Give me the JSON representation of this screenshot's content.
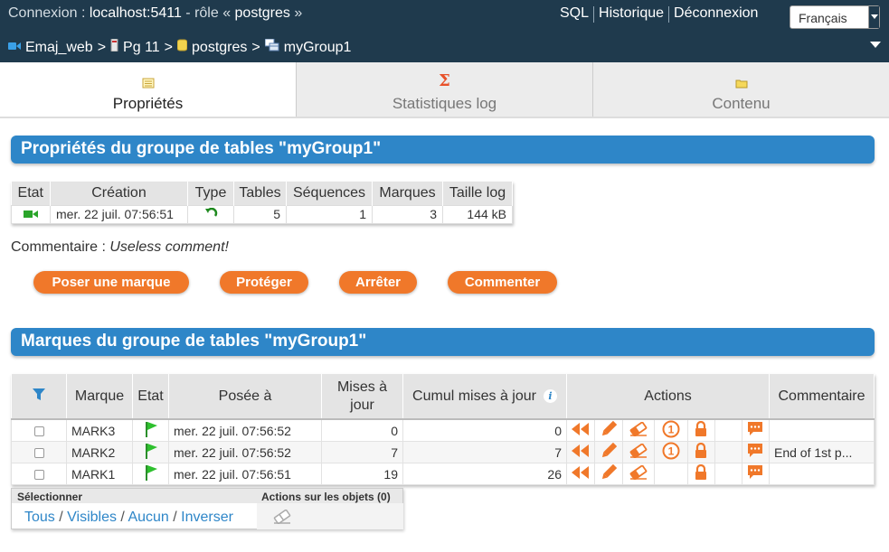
{
  "topbar": {
    "connection_prefix": "Connexion : ",
    "host": "localhost:5411",
    "role_text": " - rôle « ",
    "role": "postgres",
    "role_end": " »",
    "links": [
      "SQL",
      "Historique",
      "Déconnexion"
    ],
    "language": "Français"
  },
  "breadcrumb": [
    "Emaj_web",
    "Pg 11",
    "postgres",
    "myGroup1"
  ],
  "tabs": [
    {
      "label": "Propriétés",
      "icon": "properties-icon"
    },
    {
      "label": "Statistiques log",
      "icon": "sigma-icon"
    },
    {
      "label": "Contenu",
      "icon": "folder-icon"
    }
  ],
  "colors": {
    "header": "#1f3a4d",
    "section": "#2e86c8",
    "button": "#f0782a",
    "icon_orange": "#f0782a"
  },
  "properties": {
    "title": "Propriétés du groupe de tables \"myGroup1\"",
    "headers": [
      "Etat",
      "Création",
      "Type",
      "Tables",
      "Séquences",
      "Marques",
      "Taille log"
    ],
    "row": {
      "created": "mer. 22 juil. 07:56:51",
      "tables": "5",
      "sequences": "1",
      "marks": "3",
      "log_size": "144 kB"
    },
    "comment_label": "Commentaire : ",
    "comment": "Useless comment!",
    "buttons": [
      "Poser une marque",
      "Protéger",
      "Arrêter",
      "Commenter"
    ]
  },
  "marks": {
    "title": "Marques du groupe de tables \"myGroup1\"",
    "headers": {
      "mark": "Marque",
      "state": "Etat",
      "set_at": "Posée à",
      "updates_1": "Mises à",
      "updates_2": "jour",
      "cumul": "Cumul mises à jour",
      "actions": "Actions",
      "comment": "Commentaire"
    },
    "rows": [
      {
        "mark": "MARK3",
        "set_at": "mer. 22 juil. 07:56:52",
        "updates": "0",
        "cumul": "0",
        "comment": ""
      },
      {
        "mark": "MARK2",
        "set_at": "mer. 22 juil. 07:56:52",
        "updates": "7",
        "cumul": "7",
        "comment": "End of 1st p..."
      },
      {
        "mark": "MARK1",
        "set_at": "mer. 22 juil. 07:56:51",
        "updates": "19",
        "cumul": "26",
        "comment": ""
      }
    ]
  },
  "selection": {
    "title": "Sélectionner",
    "actions_title": "Actions sur les objets (0)",
    "links": [
      "Tous",
      "Visibles",
      "Aucun",
      "Inverser"
    ]
  }
}
